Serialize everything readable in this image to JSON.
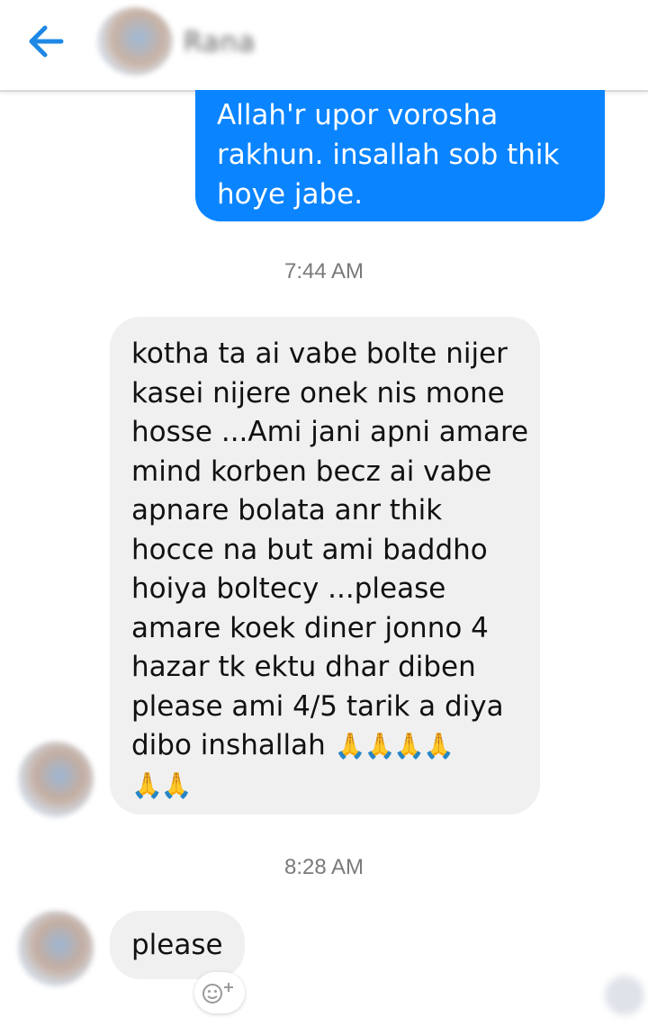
{
  "header": {
    "back_icon": "arrow-left-icon",
    "contact_name": "Rana",
    "accent_color": "#1e88e5"
  },
  "messages": {
    "outgoing_1": {
      "lines": [
        "Allah'r upor vorosha",
        "rakhun. insallah sob thik",
        "hoye jabe."
      ],
      "color": "#0a84ff"
    },
    "timestamp_1": "7:44 AM",
    "incoming_1": {
      "lines": [
        "kotha ta ai vabe bolte nijer",
        "kasei nijere onek nis mone",
        "hosse ...Ami jani apni amare",
        "mind korben becz ai vabe",
        "apnare bolata anr thik",
        "hocce na but ami baddho",
        "hoiya boltecy ...please",
        "amare koek diner jonno 4",
        "hazar tk ektu dhar diben",
        "please ami 4/5 tarik a diya",
        "dibo inshallah"
      ],
      "emoji_row_1": "🙏🙏🙏🙏",
      "emoji_row_2": "🙏🙏"
    },
    "timestamp_2": "8:28 AM",
    "incoming_2": {
      "text": "please"
    },
    "react_icon": "add-reaction-icon"
  }
}
